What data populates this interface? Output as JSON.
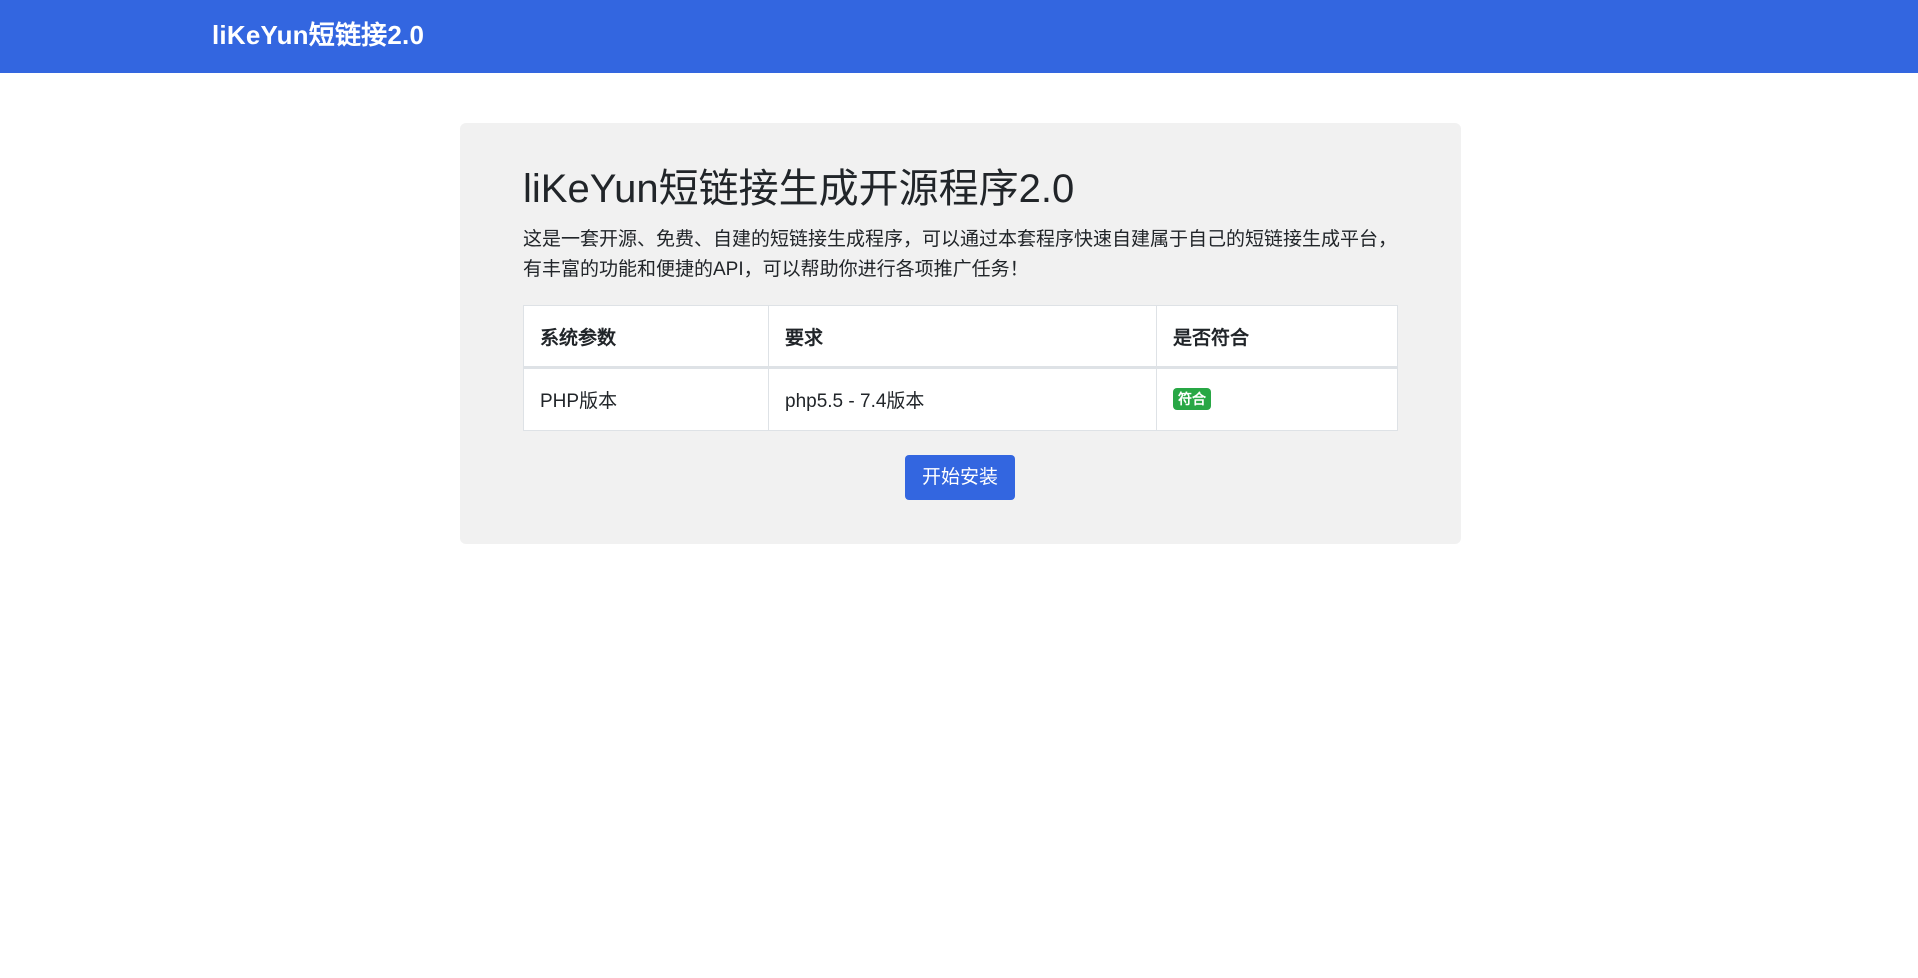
{
  "navbar": {
    "brand": "liKeYun短链接2.0",
    "background": "#3366e0"
  },
  "main": {
    "title": "liKeYun短链接生成开源程序2.0",
    "description": "这是一套开源、免费、自建的短链接生成程序，可以通过本套程序快速自建属于自己的短链接生成平台，有丰富的功能和便捷的API，可以帮助你进行各项推广任务！",
    "table": {
      "headers": [
        "系统参数",
        "要求",
        "是否符合"
      ],
      "rows": [
        {
          "param": "PHP版本",
          "requirement": "php5.5 - 7.4版本",
          "status": "符合",
          "status_color": "#28a745"
        }
      ]
    },
    "install_button": "开始安装"
  }
}
